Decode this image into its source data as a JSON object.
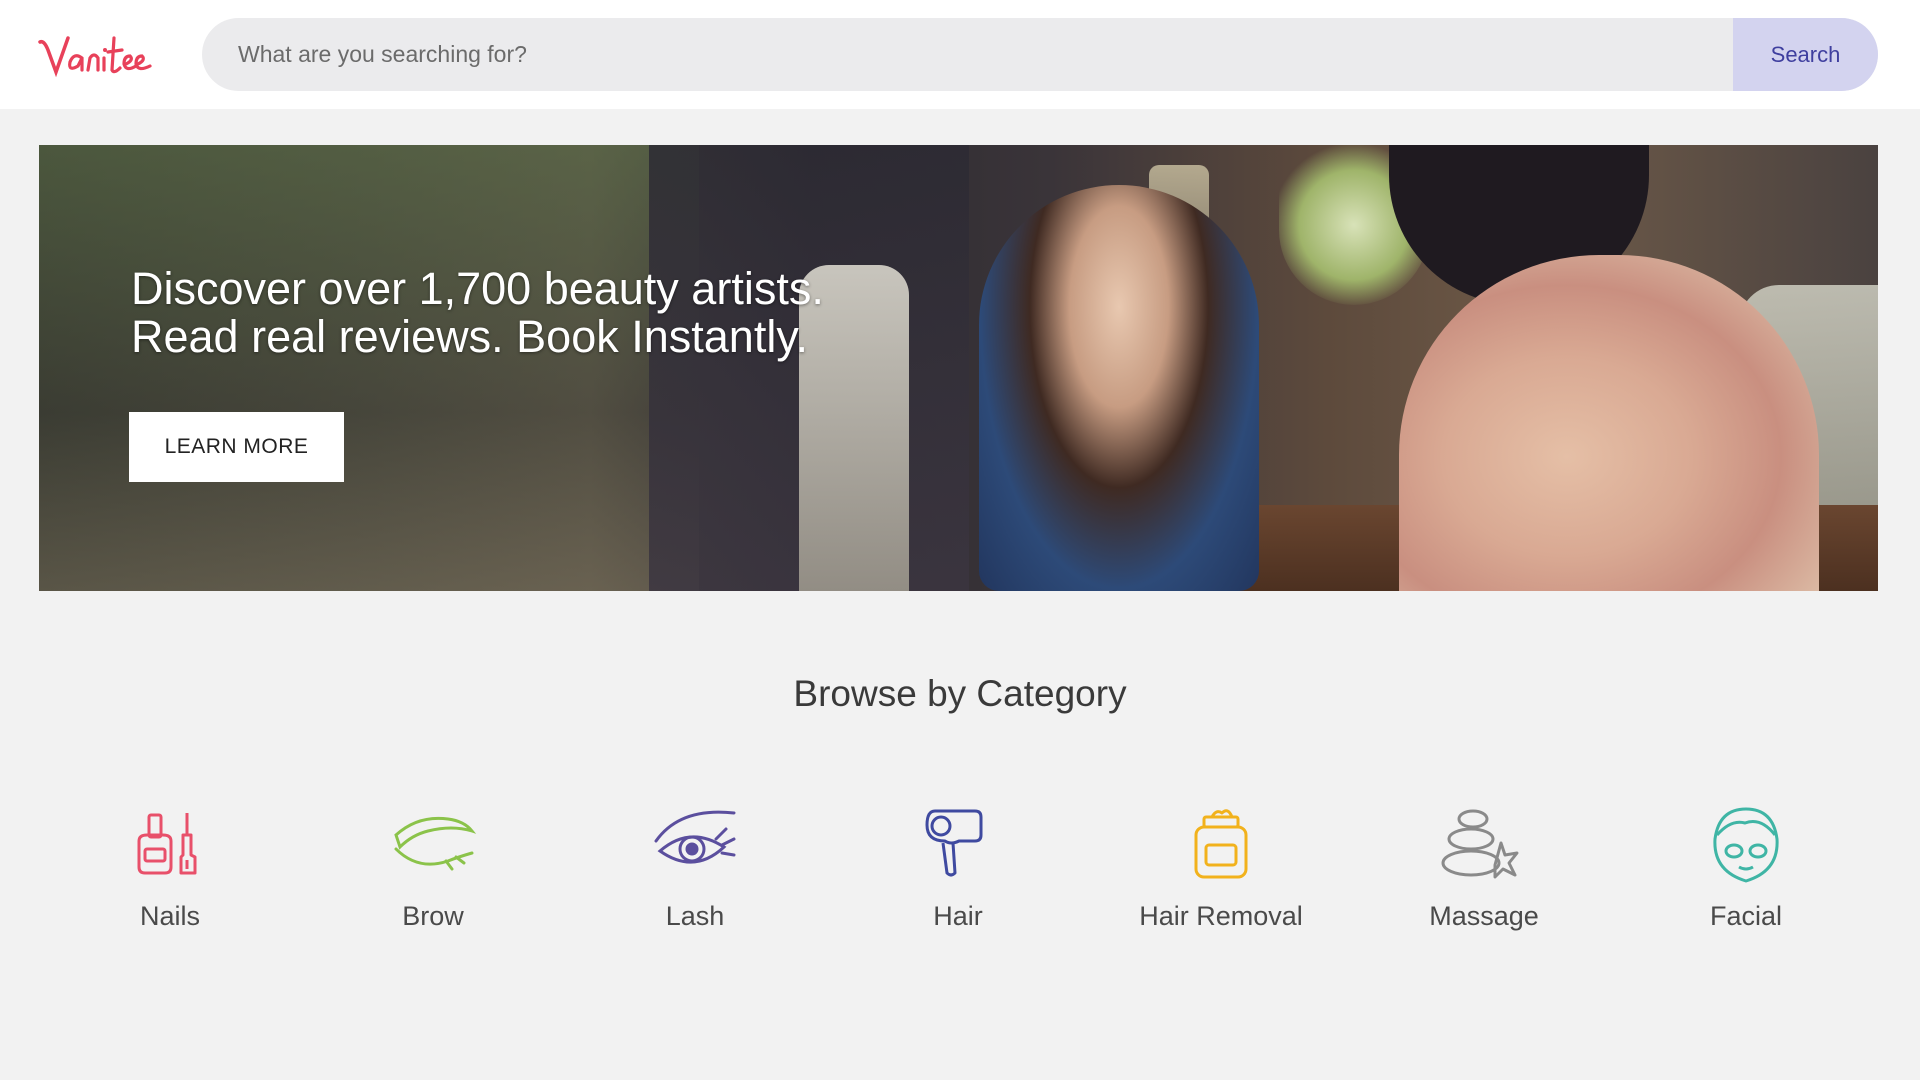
{
  "header": {
    "logo_text": "Vanitee",
    "search": {
      "placeholder": "What are you searching for?",
      "value": "",
      "button_label": "Search"
    }
  },
  "hero": {
    "headline_line1": "Discover over 1,700 beauty artists.",
    "headline_line2": "Read real reviews. Book Instantly.",
    "cta_label": "LEARN MORE"
  },
  "browse": {
    "title": "Browse by Category",
    "categories": [
      {
        "label": "Nails",
        "icon": "nail-polish-icon",
        "color": "#e8506a"
      },
      {
        "label": "Brow",
        "icon": "eyebrow-icon",
        "color": "#8bc34a"
      },
      {
        "label": "Lash",
        "icon": "eye-lash-icon",
        "color": "#5b4f9e"
      },
      {
        "label": "Hair",
        "icon": "hair-dryer-icon",
        "color": "#3f4aa0"
      },
      {
        "label": "Hair Removal",
        "icon": "wax-jar-icon",
        "color": "#f2b21c"
      },
      {
        "label": "Massage",
        "icon": "spa-stones-icon",
        "color": "#8a8a8a"
      },
      {
        "label": "Facial",
        "icon": "face-mask-icon",
        "color": "#3fb5a5"
      }
    ]
  },
  "colors": {
    "brand": "#e8415a",
    "search_button_bg": "#d3d3ef",
    "search_button_text": "#3f3f9f",
    "page_bg": "#f2f2f2"
  }
}
